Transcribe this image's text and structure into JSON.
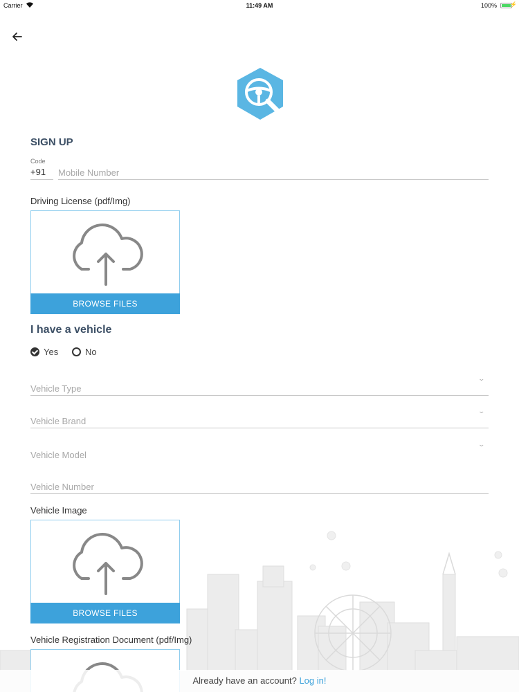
{
  "status_bar": {
    "carrier": "Carrier",
    "time": "11:49 AM",
    "battery": "100%"
  },
  "header": {
    "back_icon": "arrow-left-icon",
    "logo_icon": "steering-wheel-search-logo"
  },
  "form": {
    "title": "SIGN UP",
    "code_label": "Code",
    "code_value": "+91",
    "mobile_placeholder": "Mobile Number",
    "driving_license_label": "Driving License (pdf/Img)",
    "browse_label": "BROWSE FILES",
    "vehicle_heading": "I have a vehicle",
    "options": {
      "yes": "Yes",
      "no": "No",
      "selected": "Yes"
    },
    "vehicle_type": "Vehicle Type",
    "vehicle_brand": "Vehicle Brand",
    "vehicle_model": "Vehicle Model",
    "vehicle_number": "Vehicle Number",
    "vehicle_image_label": "Vehicle Image",
    "registration_label": "Vehicle Registration Document (pdf/Img)"
  },
  "footer": {
    "prompt": "Already have an account?",
    "login": "Log in!"
  },
  "colors": {
    "accent": "#3da2db",
    "heading": "#3c4f65",
    "logo": "#5ab6e3"
  }
}
